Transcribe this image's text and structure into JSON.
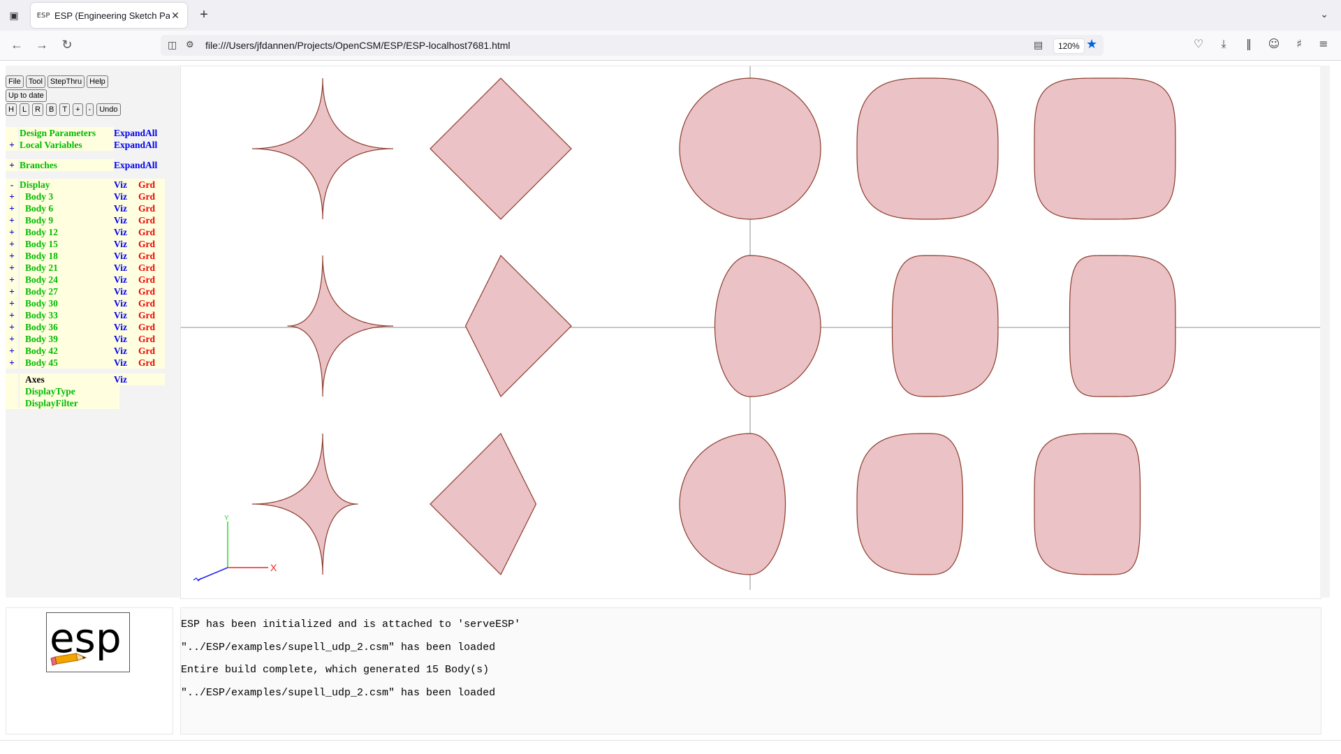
{
  "browser": {
    "tab_title": "ESP (Engineering Sketch Pad, V",
    "tab_favicon": "ESP",
    "url": "file:///Users/jfdannen/Projects/OpenCSM/ESP/ESP-localhost7681.html",
    "zoom": "120%",
    "icons": [
      "tab-list-icon",
      "back-icon",
      "forward-icon",
      "reload-icon",
      "page-icon",
      "permissions-icon",
      "reader-view-icon",
      "bookmark-star-icon",
      "pocket-icon",
      "downloads-icon",
      "library-icon",
      "account-icon",
      "extensions-icon",
      "menu-icon"
    ]
  },
  "toolbar": {
    "file": "File",
    "tool": "Tool",
    "stepthru": "StepThru",
    "help": "Help",
    "status": "Up to date",
    "view_h": "H",
    "view_l": "L",
    "view_r": "R",
    "view_b": "B",
    "view_t": "T",
    "zoom_in": "+",
    "zoom_out": "-",
    "undo": "Undo"
  },
  "tree": {
    "design_parameters": "Design Parameters",
    "local_variables": "Local Variables",
    "branches": "Branches",
    "expand_all": "ExpandAll",
    "plus": "+",
    "minus": "-",
    "display": "Display",
    "viz": "Viz",
    "grd": "Grd",
    "bodies": [
      "Body 3",
      "Body 6",
      "Body 9",
      "Body 12",
      "Body 15",
      "Body 18",
      "Body 21",
      "Body 24",
      "Body 27",
      "Body 30",
      "Body 33",
      "Body 36",
      "Body 39",
      "Body 42",
      "Body 45"
    ],
    "axes": "Axes",
    "display_type": "DisplayType",
    "display_filter": "DisplayFilter"
  },
  "graphics": {
    "fill_color": "#ebc3c7",
    "edge_color": "#8b3a2a",
    "axis_x_label": "X",
    "axis_y_label": "Y"
  },
  "logo": {
    "text": "esp"
  },
  "messages": [
    "ESP has been initialized and is attached to 'serveESP'",
    "\"../ESP/examples/supell_udp_2.csm\" has been loaded",
    "Entire build complete, which generated 15 Body(s)",
    "\"../ESP/examples/supell_udp_2.csm\" has been loaded"
  ]
}
